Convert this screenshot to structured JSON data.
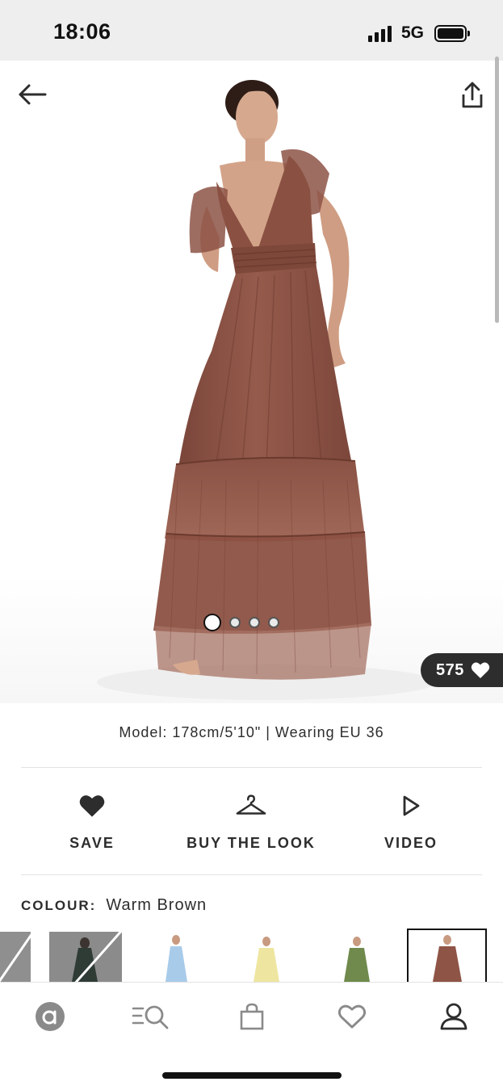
{
  "status_bar": {
    "time": "18:06",
    "network": "5G",
    "icons": [
      "signal-bars-icon",
      "battery-icon"
    ]
  },
  "header": {
    "back_icon": "arrow-left-icon",
    "share_icon": "share-icon"
  },
  "gallery": {
    "image_count": 4,
    "active_index": 0,
    "likes": "575",
    "like_icon": "heart-filled-icon"
  },
  "model_info": "Model: 178cm/5'10\" | Wearing EU 36",
  "actions": [
    {
      "label": "SAVE",
      "icon": "heart-filled-icon"
    },
    {
      "label": "BUY THE LOOK",
      "icon": "hanger-icon"
    },
    {
      "label": "VIDEO",
      "icon": "play-outline-icon"
    }
  ],
  "colour": {
    "label": "COLOUR:",
    "value": "Warm Brown",
    "swatches": [
      {
        "color": "Grey",
        "available": false
      },
      {
        "color": "Dark Green",
        "available": false
      },
      {
        "color": "Light Blue",
        "available": true
      },
      {
        "color": "Lemon",
        "available": true
      },
      {
        "color": "Olive",
        "available": true
      },
      {
        "color": "Warm Brown",
        "available": true,
        "selected": true
      }
    ]
  },
  "bottom_nav": [
    {
      "name": "home",
      "icon": "asos-logo-icon"
    },
    {
      "name": "search",
      "icon": "search-menu-icon"
    },
    {
      "name": "bag",
      "icon": "bag-icon"
    },
    {
      "name": "saved",
      "icon": "heart-outline-icon"
    },
    {
      "name": "account",
      "icon": "user-icon"
    }
  ],
  "colors": {
    "accent": "#2d2d2d",
    "dress": "#8e5446",
    "status_bar_bg": "#eeeeee"
  }
}
